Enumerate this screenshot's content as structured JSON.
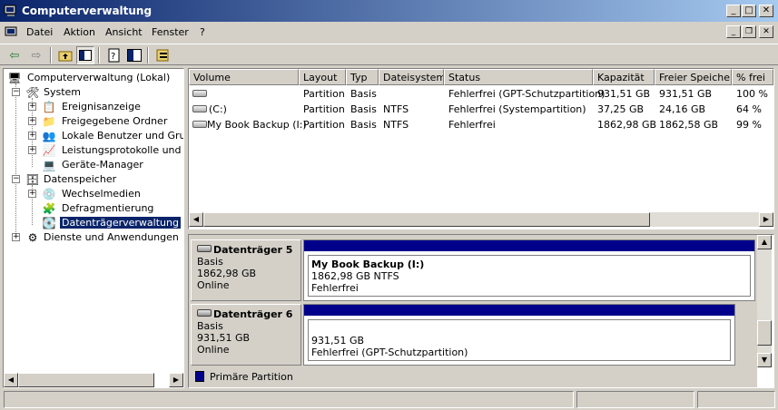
{
  "window": {
    "title": "Computerverwaltung",
    "title_icon": "computer-management-icon"
  },
  "menubar": {
    "items": [
      {
        "label": "Datei",
        "accel": "D"
      },
      {
        "label": "Aktion",
        "accel": "k"
      },
      {
        "label": "Ansicht",
        "accel": "A"
      },
      {
        "label": "Fenster",
        "accel": "F"
      },
      {
        "label": "?",
        "accel": "?"
      }
    ]
  },
  "toolbar": {
    "buttons": [
      "back-arrow-icon",
      "forward-arrow-icon",
      "up-folder-icon",
      "show-hide-tree-icon",
      "properties-icon",
      "help-icon",
      "export-list-icon"
    ]
  },
  "tree": {
    "items": [
      {
        "label": "Computerverwaltung (Lokal)",
        "icon": "computer-icon"
      },
      {
        "label": "System",
        "icon": "tools-icon",
        "expander": "−"
      },
      {
        "label": "Ereignisanzeige",
        "icon": "event-viewer-icon",
        "expander": "+"
      },
      {
        "label": "Freigegebene Ordner",
        "icon": "shared-folder-icon",
        "expander": "+"
      },
      {
        "label": "Lokale Benutzer und Gruppe",
        "icon": "users-icon",
        "expander": "+"
      },
      {
        "label": "Leistungsprotokolle und War",
        "icon": "performance-icon",
        "expander": "+"
      },
      {
        "label": "Geräte-Manager",
        "icon": "device-manager-icon"
      },
      {
        "label": "Datenspeicher",
        "icon": "storage-icon",
        "expander": "−"
      },
      {
        "label": "Wechselmedien",
        "icon": "removable-media-icon",
        "expander": "+"
      },
      {
        "label": "Defragmentierung",
        "icon": "defrag-icon"
      },
      {
        "label": "Datenträgerverwaltung",
        "icon": "disk-management-icon",
        "selected": true
      },
      {
        "label": "Dienste und Anwendungen",
        "icon": "services-icon",
        "expander": "+"
      }
    ]
  },
  "volume_list": {
    "columns": [
      "Volume",
      "Layout",
      "Typ",
      "Dateisystem",
      "Status",
      "Kapazität",
      "Freier Speicher",
      "% frei"
    ],
    "rows": [
      [
        "",
        "Partition",
        "Basis",
        "",
        "Fehlerfrei (GPT-Schutzpartition)",
        "931,51 GB",
        "931,51 GB",
        "100 %"
      ],
      [
        "(C:)",
        "Partition",
        "Basis",
        "NTFS",
        "Fehlerfrei (Systempartition)",
        "37,25 GB",
        "24,16 GB",
        "64 %"
      ],
      [
        "My Book Backup (I:)",
        "Partition",
        "Basis",
        "NTFS",
        "Fehlerfrei",
        "1862,98 GB",
        "1862,58 GB",
        "99 %"
      ]
    ]
  },
  "disks": [
    {
      "name": "Datenträger 5",
      "type": "Basis",
      "size": "1862,98 GB",
      "status": "Online",
      "partition": {
        "title": "My Book Backup  (I:)",
        "line1": "1862,98 GB NTFS",
        "line2": "Fehlerfrei"
      }
    },
    {
      "name": "Datenträger 6",
      "type": "Basis",
      "size": "931,51 GB",
      "status": "Online",
      "partition": {
        "title": "",
        "line1": "931,51 GB",
        "line2": "Fehlerfrei (GPT-Schutzpartition)"
      }
    }
  ],
  "legend": {
    "label": "Primäre Partition",
    "color": "#00008b"
  },
  "colors": {
    "titlebar_start": "#0a246a",
    "titlebar_end": "#a6caf0",
    "selection": "#0a246a",
    "partition_bar": "#00008b"
  }
}
